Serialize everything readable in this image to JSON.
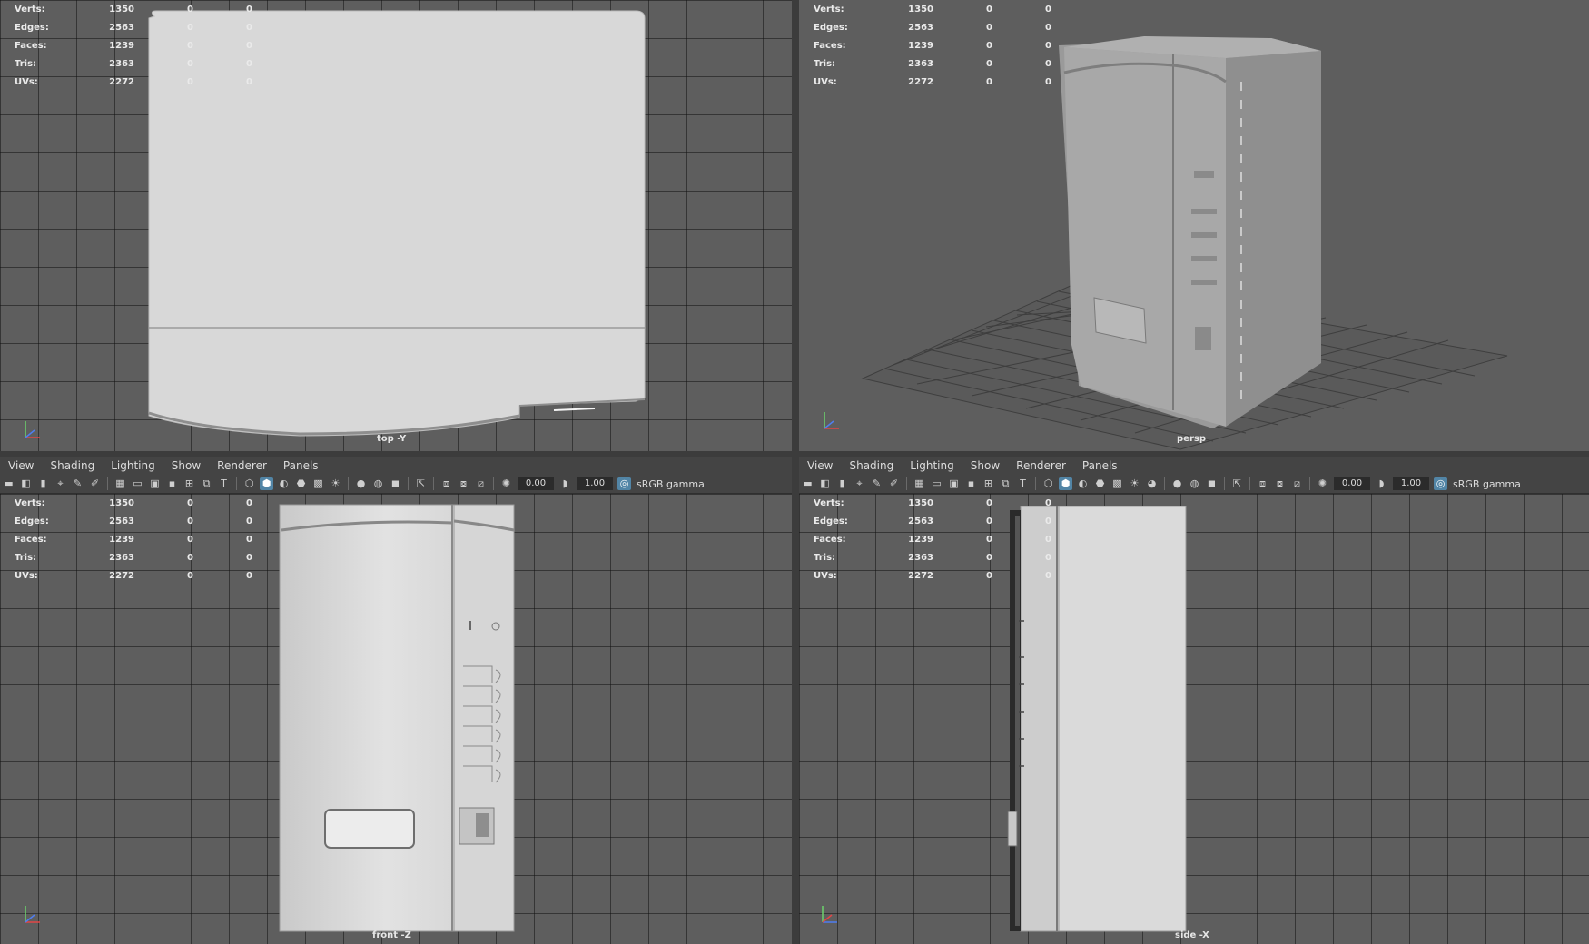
{
  "stats": {
    "rows": [
      {
        "label": "Verts:",
        "v1": "1350",
        "v2": "0",
        "v3": "0"
      },
      {
        "label": "Edges:",
        "v1": "2563",
        "v2": "0",
        "v3": "0"
      },
      {
        "label": "Faces:",
        "v1": "1239",
        "v2": "0",
        "v3": "0"
      },
      {
        "label": "Tris:",
        "v1": "2363",
        "v2": "0",
        "v3": "0"
      },
      {
        "label": "UVs:",
        "v1": "2272",
        "v2": "0",
        "v3": "0"
      }
    ]
  },
  "viewports": {
    "top": {
      "camera": "top -Y"
    },
    "persp": {
      "camera": "persp"
    },
    "front": {
      "camera": "front -Z"
    },
    "side": {
      "camera": "side -X"
    }
  },
  "menu": {
    "view": "View",
    "shading": "Shading",
    "lighting": "Lighting",
    "show": "Show",
    "renderer": "Renderer",
    "panels": "Panels"
  },
  "toolbar": {
    "exposure": "0.00",
    "gamma": "1.00",
    "colorspace": "sRGB gamma"
  },
  "colors": {
    "viewport_bg": "#5e5e5e",
    "grid": "#3a3a3a",
    "active_icon": "#5285a6",
    "model": "#d6d6d6"
  }
}
